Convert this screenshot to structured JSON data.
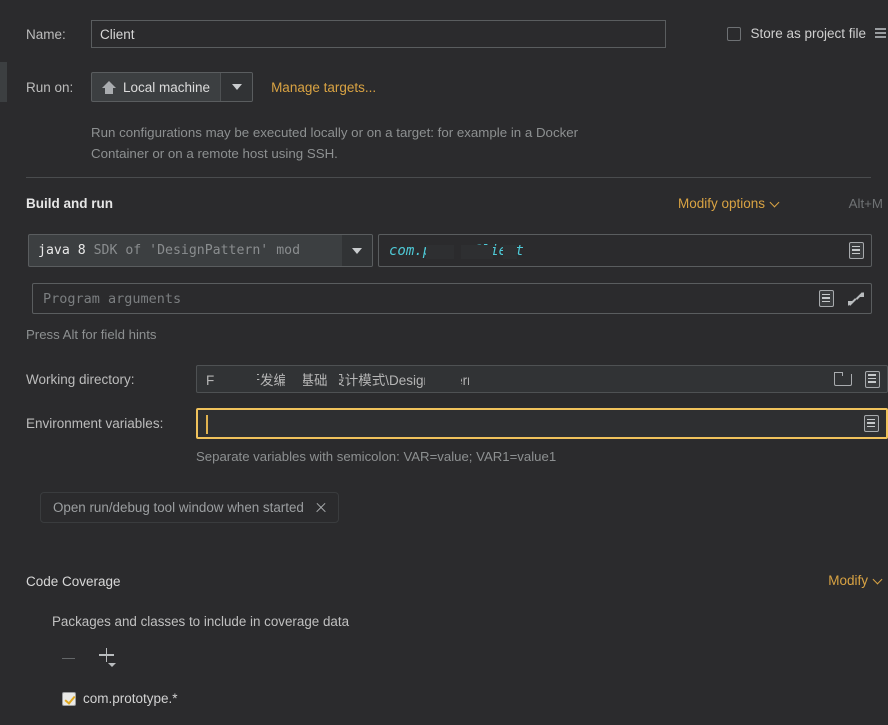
{
  "name_row": {
    "label": "Name:",
    "value": "Client"
  },
  "store_as_project_file": {
    "label": "Store as project file",
    "checked": false,
    "icon": "config-lines-icon"
  },
  "run_on": {
    "label": "Run on:",
    "selected": "Local machine",
    "icon": "home-icon",
    "manage_targets_link": "Manage targets..."
  },
  "description": "Run configurations may be executed locally or on a target: for example in a Docker Container or on a remote host using SSH.",
  "build_and_run": {
    "title": "Build and run",
    "modify_options_label": "Modify options",
    "modify_options_shortcut": "Alt+M",
    "sdk": {
      "highlight": "java 8",
      "rest": " SDK of 'DesignPattern' mod"
    },
    "main_class": {
      "prefix": "com.",
      "mid": "p",
      "mid2": "g",
      "suffix": ".Client",
      "full_visible": "com.p        g. .Client"
    },
    "program_arguments_placeholder": "Program arguments",
    "field_hint": "Press Alt for field hints"
  },
  "working_directory": {
    "label": "Working directory:",
    "value_start": "F:",
    "value_obscured": "\\java开发编程基础\\设计模式\\DesignPatt",
    "value_end": "ern",
    "browse_icon": "folder-icon",
    "macro_icon": "list-icon"
  },
  "environment_variables": {
    "label": "Environment variables:",
    "value": "",
    "focused": true,
    "editor_icon": "list-icon",
    "hint": "Separate variables with semicolon: VAR=value; VAR1=value1"
  },
  "option_chip": {
    "label": "Open run/debug tool window when started",
    "remove_icon": "close-icon"
  },
  "code_coverage": {
    "title": "Code Coverage",
    "modify_label": "Modify",
    "subtitle": "Packages and classes to include in coverage data",
    "remove_icon": "minus-icon",
    "add_icon": "plus-icon",
    "items": [
      {
        "label": "com.prototype.*",
        "checked": true
      }
    ]
  },
  "colors": {
    "background": "#2b2b2d",
    "field_background": "#2b2b2d",
    "combo_background": "#3c3f41",
    "border": "#5a5d5f",
    "accent_gold": "#d9a343",
    "focus_gold": "#f0c25c",
    "main_class_cyan": "#4ec9d6",
    "text_primary": "#bcbcbc",
    "text_dim": "#8d9091"
  }
}
